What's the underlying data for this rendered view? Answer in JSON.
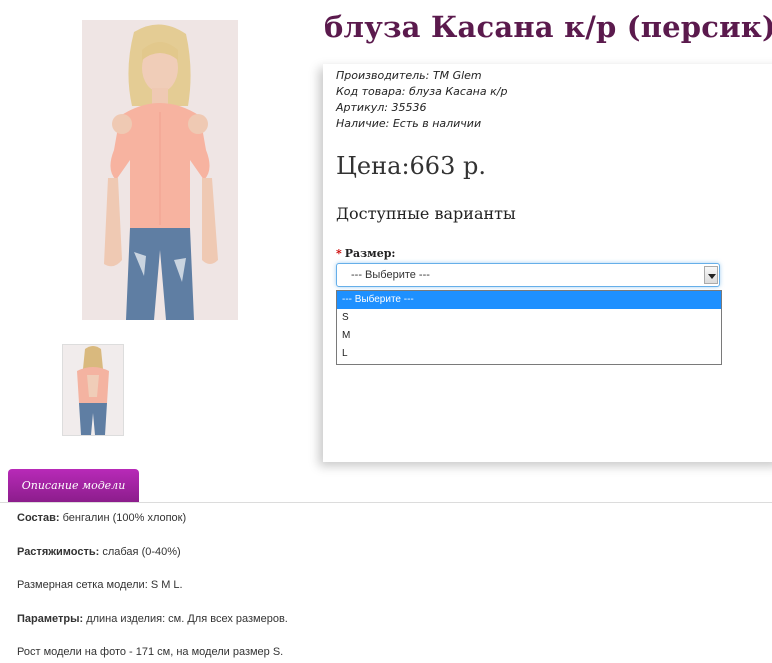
{
  "product": {
    "title": "блуза Касана к/р (персик)",
    "meta": [
      {
        "label": "Производитель:",
        "value": "TM Glem"
      },
      {
        "label": "Код товара:",
        "value": "блуза Касана к/р"
      },
      {
        "label": "Артикул:",
        "value": "35536"
      },
      {
        "label": "Наличие:",
        "value": "Есть в наличии"
      }
    ],
    "price": "Цена:663 р.",
    "variants_heading": "Доступные варианты",
    "size_label": "Размер:",
    "required_mark": "*"
  },
  "size_select": {
    "selected": "--- Выберите ---",
    "options": [
      "--- Выберите ---",
      "S",
      "M",
      "L"
    ]
  },
  "tabs": {
    "description": "Описание модели"
  },
  "description": [
    {
      "label": "Состав:",
      "value": " бенгалин (100% хлопок)"
    },
    {
      "label": "Растяжимость:",
      "value": " слабая (0-40%)"
    },
    {
      "label": "",
      "value": "Размерная сетка модели: S M L."
    },
    {
      "label": "Параметры:",
      "value": " длина изделия: см. Для всех размеров."
    },
    {
      "label": "",
      "value": "Рост модели на фото - 171 см, на модели размер S."
    }
  ],
  "colors": {
    "title": "#5b1a4d",
    "tab": "#a023a0",
    "select_highlight": "#1e90ff"
  }
}
